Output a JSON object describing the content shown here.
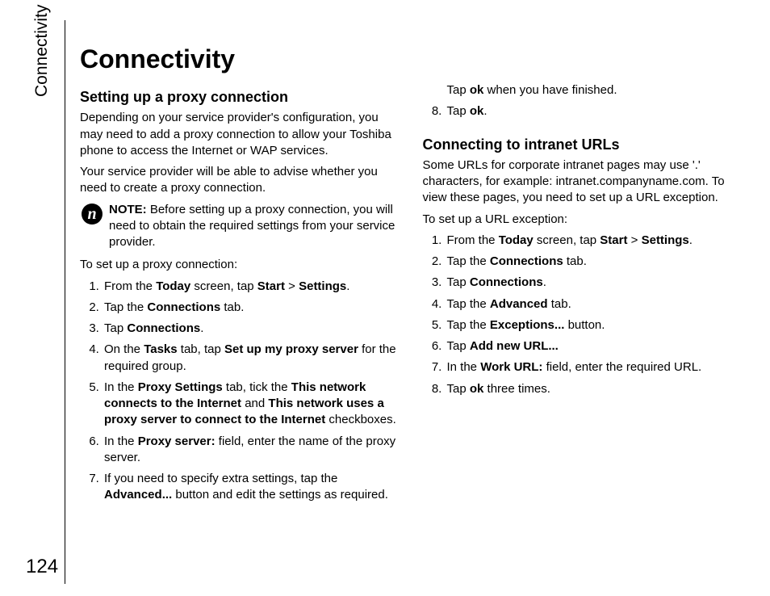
{
  "sidebarLabel": "Connectivity",
  "pageNumber": "124",
  "mainTitle": "Connectivity",
  "col1": {
    "heading1": "Setting up a proxy connection",
    "intro1": "Depending on your service provider's configuration, you may need to add a proxy connection to allow your Toshiba phone to access the Internet or WAP services.",
    "intro2": "Your service provider will be able to advise whether you need to create a proxy connection.",
    "noteLabel": "NOTE:",
    "noteText": " Before setting up a proxy connection, you will need to obtain the required settings from your service provider.",
    "listLead": "To set up a proxy connection:",
    "s1a": "From the ",
    "s1b": "Today",
    "s1c": " screen, tap ",
    "s1d": "Start",
    "s1e": " > ",
    "s1f": "Settings",
    "s1g": ".",
    "s2a": "Tap the ",
    "s2b": "Connections",
    "s2c": " tab.",
    "s3a": "Tap ",
    "s3b": "Connections",
    "s3c": ".",
    "s4a": "On the ",
    "s4b": "Tasks",
    "s4c": " tab, tap ",
    "s4d": "Set up my proxy server",
    "s4e": " for the required group.",
    "s5a": "In the ",
    "s5b": "Proxy Settings",
    "s5c": " tab, tick the ",
    "s5d": "This network connects to the Internet",
    "s5e": " and ",
    "s5f": "This network uses a proxy server to connect to the Internet",
    "s5g": " checkboxes.",
    "s6a": "In the ",
    "s6b": "Proxy server:",
    "s6c": " field, enter the name of the proxy server.",
    "s7a": "If you need to specify extra settings, tap the ",
    "s7b": "Advanced...",
    "s7c": " button and edit the settings as required."
  },
  "col2": {
    "contA": "Tap ",
    "contB": "ok",
    "contC": " when you have finished.",
    "s8a": "Tap ",
    "s8b": "ok",
    "s8c": ".",
    "heading2": "Connecting to intranet URLs",
    "intro3": "Some URLs for corporate intranet pages may use '.' characters, for example: intranet.companyname.com. To view these pages, you need to set up a URL exception.",
    "listLead2": "To set up a URL exception:",
    "t1a": "From the ",
    "t1b": "Today",
    "t1c": " screen, tap ",
    "t1d": "Start",
    "t1e": " > ",
    "t1f": "Settings",
    "t1g": ".",
    "t2a": "Tap the ",
    "t2b": "Connections",
    "t2c": " tab.",
    "t3a": "Tap ",
    "t3b": "Connections",
    "t3c": ".",
    "t4a": "Tap the ",
    "t4b": "Advanced",
    "t4c": " tab.",
    "t5a": "Tap the ",
    "t5b": "Exceptions...",
    "t5c": " button.",
    "t6a": "Tap ",
    "t6b": "Add new URL...",
    "t7a": "In the ",
    "t7b": "Work URL:",
    "t7c": " field, enter the required URL.",
    "t8a": "Tap ",
    "t8b": "ok",
    "t8c": " three times."
  }
}
